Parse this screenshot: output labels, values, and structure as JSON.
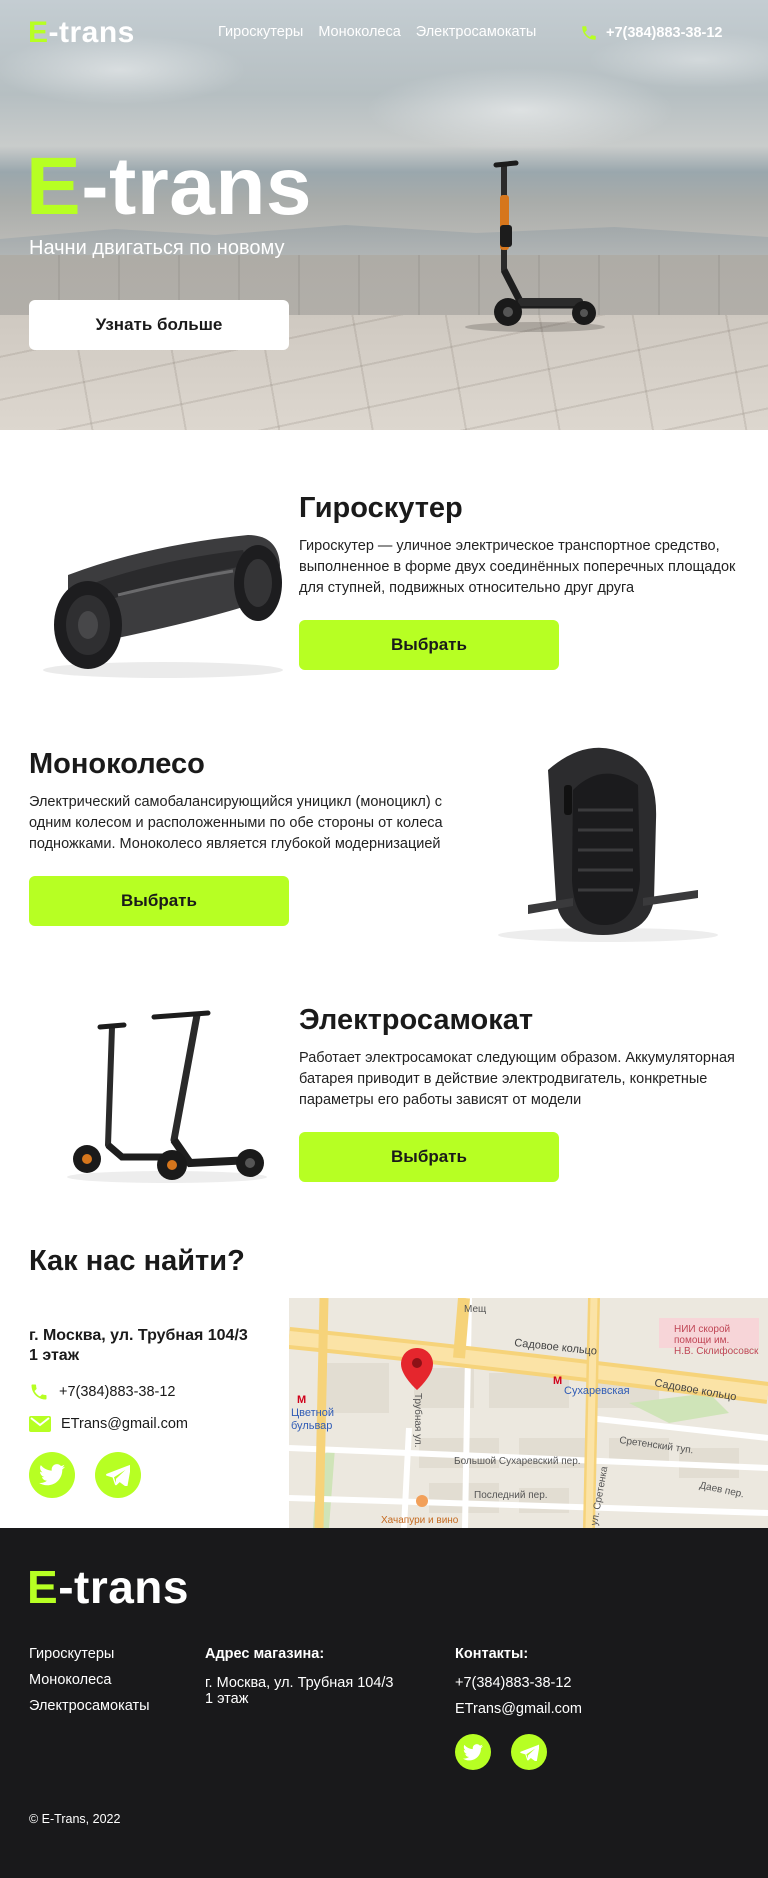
{
  "brand": {
    "logo_e": "E",
    "logo_rest": "-trans",
    "accent_color": "#b7ff23",
    "dark_color": "#19191b"
  },
  "nav": {
    "links": [
      "Гироскутеры",
      "Моноколеса",
      "Электросамокаты"
    ],
    "phone": "+7(384)883-38-12",
    "phone_icon": "phone-icon"
  },
  "hero": {
    "title_e": "E",
    "title_rest": "-trans",
    "subtitle": "Начни двигаться по новому",
    "button": "Узнать больше"
  },
  "products": [
    {
      "title": "Гироскутер",
      "description": "Гироскутер  — уличное электрическое транспортное средство, выполненное в форме двух соединённых поперечных площадок для ступней, подвижных относительно друг друга",
      "button": "Выбрать",
      "image": "hoverboard-image"
    },
    {
      "title": "Моноколесо",
      "description": "Электрический самобалансирующийся уницикл (моноцикл) с одним колесом и расположенными по обе стороны от колеса подножками. Моноколесо является глубокой модернизацией",
      "button": "Выбрать",
      "image": "monowheel-image"
    },
    {
      "title": "Электросамокат",
      "description": "Работает электросамокат следующим образом. Аккумуляторная батарея приводит в действие электродвигатель, конкретные параметры его работы зависят от модели",
      "button": "Выбрать",
      "image": "scooters-image"
    }
  ],
  "find_us": {
    "title": "Как нас найти?",
    "address_line1": "г. Москва, ул. Трубная 104/3",
    "address_line2": "1 этаж",
    "phone": "+7(384)883-38-12",
    "email": "ETrans@gmail.com",
    "socials": [
      "twitter-icon",
      "telegram-icon"
    ]
  },
  "map": {
    "labels": {
      "meshch": "Мещ",
      "sadovoe1": "Садовое кольцо",
      "sadovoe2": "Садовое кольцо",
      "sukharevskaya": "Сухаревская",
      "nii1": "НИИ скорой",
      "nii2": "помощи им.",
      "nii3": "Н.В. Склифосовск",
      "tsvetnoy1": "Цветной",
      "tsvetnoy2": "бульвар",
      "trubnaya": "Трубная ул.",
      "bolshoy": "Большой Сухаревский пер.",
      "sretensky": "Сретенский туп.",
      "posledny": "Последний пер.",
      "dayev": "Даев пер.",
      "khachapuri": "Хачапури и вино",
      "ulsretenka": "ул. Сретенка",
      "metro": "М"
    }
  },
  "footer": {
    "logo_e": "E",
    "logo_rest": "-trans",
    "col1": [
      "Гироскутеры",
      "Моноколеса",
      "Электросамокаты"
    ],
    "col2_head": "Адрес магазина:",
    "col2_line1": "г. Москва, ул. Трубная 104/3",
    "col2_line2": "1 этаж",
    "col3_head": "Контакты:",
    "col3_phone": "+7(384)883-38-12",
    "col3_email": "ETrans@gmail.com",
    "copyright": "© E-Trans, 2022"
  }
}
